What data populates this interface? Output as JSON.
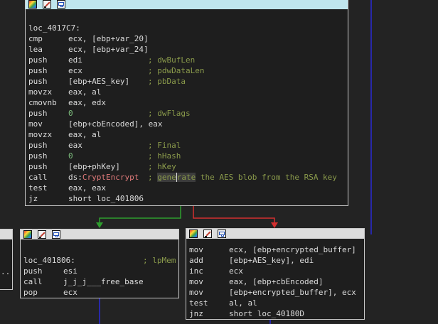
{
  "top_node": {
    "label": "loc_4017C7:",
    "rows": [
      {
        "mn": "cmp",
        "op": "ecx, [ebp+var_20]",
        "cm": ""
      },
      {
        "mn": "lea",
        "op": "ecx, [ebp+var_24]",
        "cm": ""
      },
      {
        "mn": "push",
        "op": "edi",
        "cm": "; dwBufLen"
      },
      {
        "mn": "push",
        "op": "ecx",
        "cm": "; pdwDataLen"
      },
      {
        "mn": "push",
        "op": "[ebp+AES_key]",
        "cm": "; pbData"
      },
      {
        "mn": "movzx",
        "op": "eax, al",
        "cm": ""
      },
      {
        "mn": "cmovnb",
        "op": "eax, edx",
        "cm": ""
      },
      {
        "mn": "push",
        "op": "0",
        "cm": "; dwFlags"
      },
      {
        "mn": "mov",
        "op": "[ebp+cbEncoded], eax",
        "cm": ""
      },
      {
        "mn": "movzx",
        "op": "eax, al",
        "cm": ""
      },
      {
        "mn": "push",
        "op": "eax",
        "cm": "; Final"
      },
      {
        "mn": "push",
        "op": "0",
        "cm": "; hHash"
      },
      {
        "mn": "push",
        "op": "[ebp+phKey]",
        "cm": "; hKey"
      }
    ],
    "call_row": {
      "mn": "call",
      "op_prefix": "ds:",
      "op_fn": "CryptEncrypt",
      "cm_semicolon": ";",
      "cm_highlight_a": "gene",
      "cm_highlight_b": "rate",
      "cm_rest": " the AES blob from the RSA key"
    },
    "tail_rows": [
      {
        "mn": "test",
        "op": "eax, eax",
        "cm": ""
      },
      {
        "mn": "jz",
        "op": "short loc_401806",
        "cm": ""
      }
    ]
  },
  "left_node": {
    "label": "loc_401806:",
    "label_comment": "; lpMem",
    "rows": [
      {
        "mn": "push",
        "op": "esi"
      },
      {
        "mn": "call",
        "op": "j_j_j___free_base"
      },
      {
        "mn": "pop",
        "op": "ecx"
      }
    ]
  },
  "right_node": {
    "rows": [
      {
        "mn": "mov",
        "op": "ecx, [ebp+encrypted_buffer]"
      },
      {
        "mn": "add",
        "op": "[ebp+AES_key], edi"
      },
      {
        "mn": "inc",
        "op": "ecx"
      },
      {
        "mn": "mov",
        "op": "eax, [ebp+cbEncoded]"
      },
      {
        "mn": "mov",
        "op": "[ebp+encrypted_buffer], ecx"
      },
      {
        "mn": "test",
        "op": "al, al"
      },
      {
        "mn": "jnz",
        "op": "short loc_40180D"
      }
    ]
  },
  "far_left_node": {
    "text": ".."
  },
  "colors": {
    "true_edge": "#2e9e2e",
    "false_edge": "#d32f2f",
    "flow_edge": "#2a2ad6"
  },
  "icons": [
    "palette-icon",
    "edit-color-icon",
    "graph-overview-icon"
  ]
}
